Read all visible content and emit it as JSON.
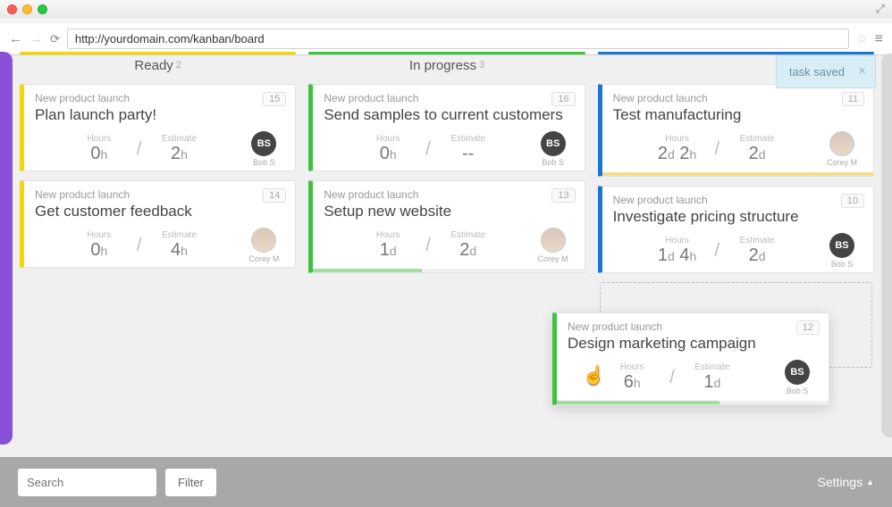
{
  "browser": {
    "url": "http://yourdomain.com/kanban/board"
  },
  "toast": {
    "message": "task saved"
  },
  "columns": [
    {
      "title": "Ready",
      "count": "2",
      "accent": "yellow"
    },
    {
      "title": "In progress",
      "count": "3",
      "accent": "green"
    },
    {
      "title": "",
      "count": "",
      "accent": "blue"
    }
  ],
  "cards": {
    "ready": [
      {
        "proj": "New product launch",
        "num": "15",
        "title": "Plan launch party!",
        "hours": "0h",
        "estimate": "2h",
        "assignee": "Bob S",
        "avatarType": "initials",
        "initials": "BS"
      },
      {
        "proj": "New product launch",
        "num": "14",
        "title": "Get customer feedback",
        "hours": "0h",
        "estimate": "4h",
        "assignee": "Corey M",
        "avatarType": "photo"
      }
    ],
    "progress": [
      {
        "proj": "New product launch",
        "num": "16",
        "title": "Send samples to current customers",
        "hours": "0h",
        "estimate": "--",
        "assignee": "Bob S",
        "avatarType": "initials",
        "initials": "BS"
      },
      {
        "proj": "New product launch",
        "num": "13",
        "title": "Setup new website",
        "hours": "1d",
        "estimate": "2d",
        "assignee": "Corey M",
        "avatarType": "photo",
        "progressPct": 40,
        "progressColor": "#9fe09f"
      }
    ],
    "third": [
      {
        "proj": "New product launch",
        "num": "11",
        "title": "Test manufacturing",
        "hours": "2d 2h",
        "estimate": "2d",
        "assignee": "Corey M",
        "avatarType": "photo",
        "progressPct": 100,
        "progressColor": "#f7dd89"
      },
      {
        "proj": "New product launch",
        "num": "10",
        "title": "Investigate pricing structure",
        "hours": "1d 4h",
        "estimate": "2d",
        "assignee": "Bob S",
        "avatarType": "initials",
        "initials": "BS"
      }
    ],
    "dragging": {
      "proj": "New product launch",
      "num": "12",
      "title": "Design marketing campaign",
      "hours": "6h",
      "estimate": "1d",
      "assignee": "Bob S",
      "avatarType": "initials",
      "initials": "BS",
      "progressPct": 60,
      "progressColor": "#9fe09f"
    }
  },
  "labels": {
    "hours": "Hours",
    "estimate": "Estimate"
  },
  "bottombar": {
    "searchPlaceholder": "Search",
    "filter": "Filter",
    "settings": "Settings"
  }
}
